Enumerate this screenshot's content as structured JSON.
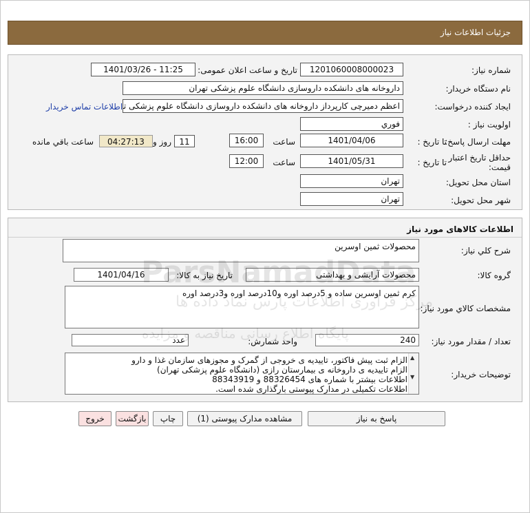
{
  "header": {
    "title": "جزئیات اطلاعات نیاز"
  },
  "top": {
    "need_number_label": "شماره نیاز:",
    "need_number": "1201060008000023",
    "announce_label": "تاریخ و ساعت اعلان عمومی:",
    "announce_value": "1401/03/26 - 11:25",
    "buyer_org_label": "نام دستگاه خریدار:",
    "buyer_org": "داروخانه های دانشکده داروسازی دانشگاه علوم پزشکی تهران",
    "requester_label": "ایجاد کننده درخواست:",
    "requester": "اعظم دمیرچی کارپرداز داروخانه های دانشکده داروسازی دانشگاه علوم پزشکی تهران",
    "contact_link": "اطلاعات تماس خریدار",
    "priority_label": "اولویت نیاز :",
    "priority": "فوري",
    "deadline_label": "مهلت ارسال پاسخ:",
    "to_date_label": "تا تاریخ :",
    "deadline_date": "1401/04/06",
    "time_label": "ساعت",
    "deadline_time": "16:00",
    "days_value": "11",
    "days_label": "روز و",
    "remaining_time": "04:27:13",
    "remaining_label": "ساعت باقي مانده",
    "validity_label_1": "حداقل تاریخ اعتبار",
    "validity_label_2": "قیمت:",
    "validity_to_label": "تا تاریخ :",
    "validity_date": "1401/05/31",
    "validity_time_label": "ساعت",
    "validity_time": "12:00",
    "province_label": "استان محل تحویل:",
    "province": "تهران",
    "city_label": "شهر محل تحویل:",
    "city": "تهران"
  },
  "goods": {
    "section_title": "اطلاعات کالاهای مورد نیاز",
    "desc_label": "شرح کلي نیاز:",
    "desc": "محصولات ثمین اوسرین",
    "group_label": "گروه کالا:",
    "group": "محصولات آرایشی و بهداشتی",
    "need_date_label": "تاریخ نیاز به کالا:",
    "need_date": "1401/04/16",
    "spec_label": "مشخصات کالاي مورد نیاز:",
    "spec": "کرم ثمین اوسرین ساده و 5درصد اوره و10درصد اوره و3درصد اوره",
    "qty_label": "تعداد / مقدار مورد نیاز:",
    "qty": "240",
    "unit_label": "واحد شمارش:",
    "unit": "عدد",
    "buyer_notes_label": "توضیحات خریدار:",
    "notes": [
      "الزام ثبت پیش فاکتور، تاییدیه ی خروجی از گمرک و مجوزهای سازمان غذا و دارو",
      "الزام تاییدیه ی داروخانه ی بیمارستان رازی (دانشگاه علوم پزشکی تهران)",
      "اطلاعات بیشتر با شماره های 88326454 و 88343919",
      "اطلاعات تکمیلی در مدارک پیوستی بارگذاری شده است."
    ]
  },
  "buttons": {
    "reply": "پاسخ به نیاز",
    "attachments": "مشاهده مدارک پیوستی (1)",
    "print": "چاپ",
    "back": "بازگشت",
    "exit": "خروج"
  },
  "watermark": {
    "line1": "ParsNamadData",
    "line2": "مرکز فراوری اطلاعات پارس نماد داده ها",
    "line3": "پایگاه اطلاع رسانی مناقصه و مزایده"
  }
}
